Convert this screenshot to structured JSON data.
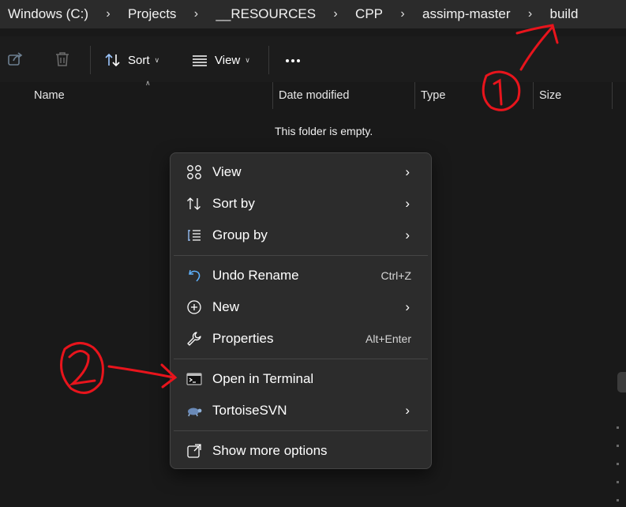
{
  "breadcrumb": [
    "Windows (C:)",
    "Projects",
    "__RESOURCES",
    "CPP",
    "assimp-master",
    "build"
  ],
  "toolbar": {
    "sort_label": "Sort",
    "view_label": "View"
  },
  "columns": {
    "name": "Name",
    "date": "Date modified",
    "type": "Type",
    "size": "Size"
  },
  "empty_message": "This folder is empty.",
  "context_menu": {
    "view": "View",
    "sort_by": "Sort by",
    "group_by": "Group by",
    "undo_rename": "Undo Rename",
    "undo_shortcut": "Ctrl+Z",
    "new": "New",
    "properties": "Properties",
    "properties_shortcut": "Alt+Enter",
    "open_terminal": "Open in Terminal",
    "tortoisesvn": "TortoiseSVN",
    "show_more": "Show more options"
  },
  "annotation_color": "#e8141c"
}
